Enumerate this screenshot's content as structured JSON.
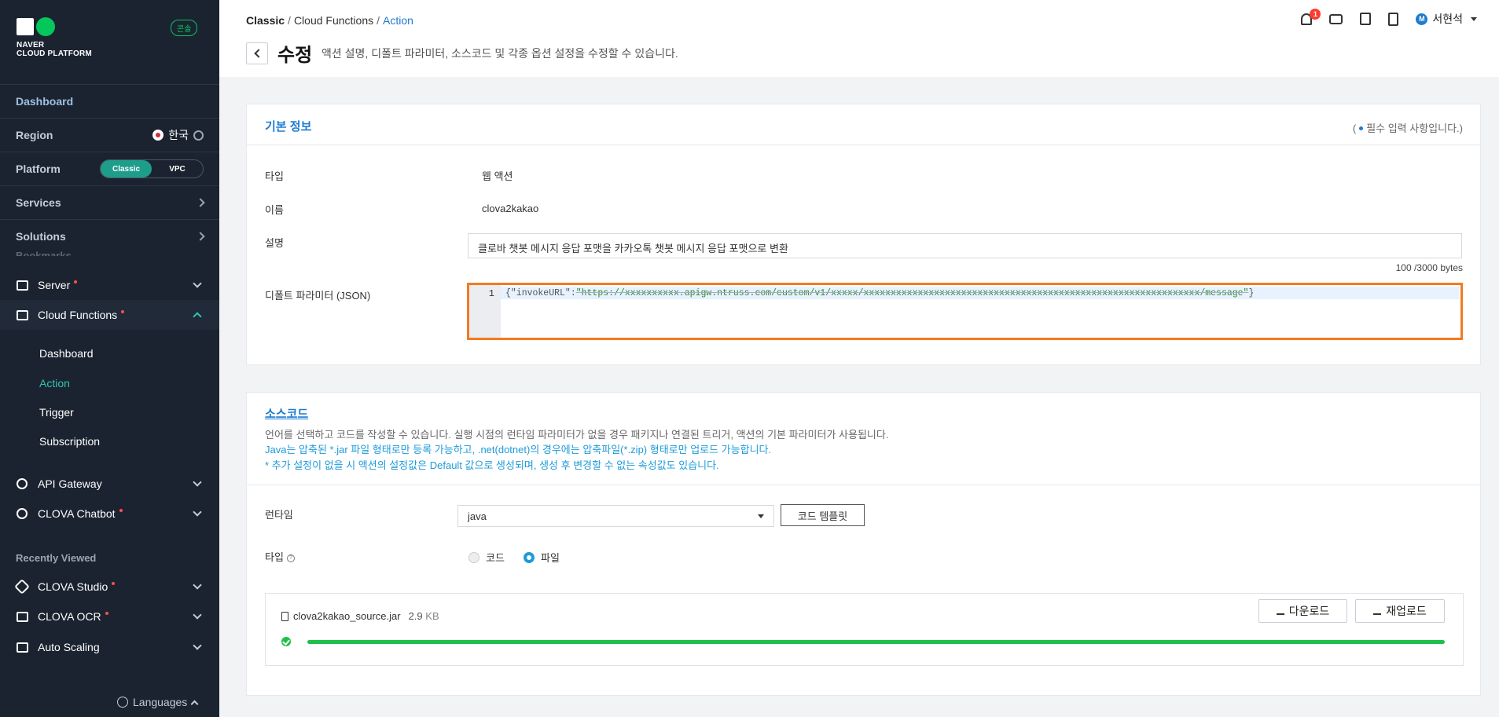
{
  "sidebar": {
    "logo_line1": "NAVER",
    "logo_line2": "CLOUD PLATFORM",
    "console_badge": "콘솔",
    "dashboard": "Dashboard",
    "region_label": "Region",
    "region_value": "한국",
    "platform_label": "Platform",
    "platform_options": [
      "Classic",
      "VPC"
    ],
    "platform_selected": "Classic",
    "services": "Services",
    "solutions": "Solutions",
    "bookmarks_partial": "Bookmarks",
    "menu": [
      {
        "label": "Server",
        "icon": "server-icon",
        "dot": true
      },
      {
        "label": "Cloud Functions",
        "icon": "cloud-functions-icon",
        "dot": true,
        "expanded": true
      }
    ],
    "cloud_functions_sub": [
      "Dashboard",
      "Action",
      "Trigger",
      "Subscription"
    ],
    "cloud_functions_active": "Action",
    "menu2": [
      {
        "label": "API Gateway",
        "icon": "api-gateway-icon",
        "dot": false
      },
      {
        "label": "CLOVA Chatbot",
        "icon": "chatbot-icon",
        "dot": true
      }
    ],
    "recently_viewed": "Recently Viewed",
    "recent": [
      {
        "label": "CLOVA Studio",
        "icon": "studio-icon",
        "dot": true
      },
      {
        "label": "CLOVA OCR",
        "icon": "ocr-icon",
        "dot": true
      },
      {
        "label": "Auto Scaling",
        "icon": "auto-scaling-icon",
        "dot": false
      }
    ],
    "languages": "Languages"
  },
  "header": {
    "breadcrumb": [
      "Classic",
      "Cloud Functions",
      "Action"
    ],
    "title": "수정",
    "description": "액션 설명, 디폴트 파라미터, 소스코드 및 각종 옵션 설정을 수정할 수 있습니다.",
    "notification_count": "1",
    "user_initial": "M",
    "user_name": "서현석"
  },
  "basic_info": {
    "title": "기본 정보",
    "required_note_prefix": "(",
    "required_note": "필수 입력 사항입니다.)",
    "type_label": "타입",
    "type_value": "웹 액션",
    "name_label": "이름",
    "name_value": "clova2kakao",
    "desc_label": "설명",
    "desc_value": "클로바 챗봇 메시지 응답 포맷을 카카오톡 챗봇 메시지 응답 포맷으로 변환",
    "desc_counter": "100 /3000 bytes",
    "param_label": "디폴트 파라미터 (JSON)",
    "param_line_no": "1",
    "param_key": "{\"invokeURL\":",
    "param_value": "\"https://xxxxxxxxxx.apigw.ntruss.com/custom/v1/xxxxx/xxxxxxxxxxxxxxxxxxxxxxxxxxxxxxxxxxxxxxxxxxxxxxxxxxxxxxxxxxxxxx/message\"",
    "param_close": "}"
  },
  "source": {
    "title": "소스코드",
    "desc1": "언어를 선택하고 코드를 작성할 수 있습니다. 실행 시점의 런타임 파라미터가 없을 경우 패키지나 연결된 트리거, 액션의 기본 파라미터가 사용됩니다.",
    "desc2": "Java는 압축된 *.jar 파일 형태로만 등록 가능하고, .net(dotnet)의 경우에는 압축파일(*.zip) 형태로만 업로드 가능합니다.",
    "desc3": "* 추가 설정이 없을 시 액션의 설정값은 Default 값으로 생성되며, 생성 후 변경할 수 없는 속성값도 있습니다.",
    "runtime_label": "런타임",
    "runtime_value": "java",
    "template_button": "코드 템플릿",
    "type_label": "타입",
    "type_options": [
      "코드",
      "파일"
    ],
    "type_selected": "파일",
    "file_name": "clova2kakao_source.jar",
    "file_size": "2.9",
    "file_size_unit": "KB",
    "download_button": "다운로드",
    "reupload_button": "재업로드",
    "upload_progress": 1.0
  },
  "colors": {
    "accent": "#1e7bd0",
    "sidebar_bg": "#1b2330",
    "active_teal": "#2fc4b2",
    "highlight_border": "#f47a20",
    "progress_green": "#1ec04a"
  }
}
